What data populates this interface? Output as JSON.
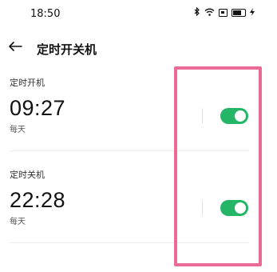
{
  "status_bar": {
    "time": "18:50",
    "icons": [
      "bluetooth-icon",
      "wifi-icon",
      "screen-icon",
      "battery-icon",
      "charging-icon"
    ]
  },
  "header": {
    "back_icon": "arrow-left-icon",
    "title": "定时开关机"
  },
  "schedules": [
    {
      "label": "定时开机",
      "time": "09:27",
      "repeat": "每天",
      "enabled": true
    },
    {
      "label": "定时关机",
      "time": "22:28",
      "repeat": "每天",
      "enabled": true
    }
  ],
  "colors": {
    "toggle_on": "#25b567",
    "highlight": "#ea6a98"
  }
}
